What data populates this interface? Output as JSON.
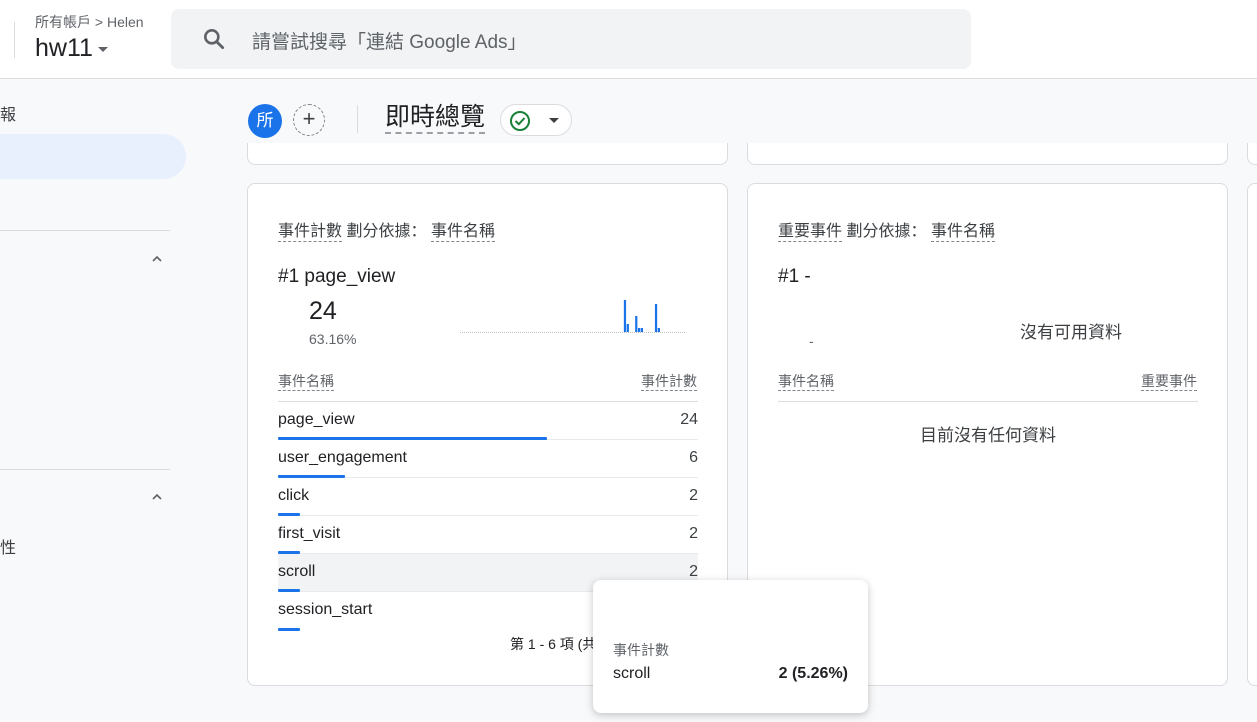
{
  "topbar": {
    "breadcrumb": "所有帳戶 > Helen",
    "account_name": "hw11",
    "search_placeholder": "請嘗試搜尋「連結 Google Ads」"
  },
  "sidebar": {
    "item_report_partial": "報",
    "item_attr_partial": "性"
  },
  "header": {
    "avatar_letter": "所",
    "add_label": "+",
    "page_title": "即時總覽"
  },
  "events_card": {
    "metric_label": "事件計數",
    "by_label": "劃分依據：",
    "dimension_label": "事件名稱",
    "top_rank": "#1",
    "top_name": "page_view",
    "top_value": "24",
    "top_percent": "63.16%",
    "col_name": "事件名稱",
    "col_value": "事件計數",
    "rows": [
      {
        "name": "page_view",
        "value": "24"
      },
      {
        "name": "user_engagement",
        "value": "6"
      },
      {
        "name": "click",
        "value": "2"
      },
      {
        "name": "first_visit",
        "value": "2"
      },
      {
        "name": "scroll",
        "value": "2"
      },
      {
        "name": "session_start",
        "value": ""
      }
    ],
    "pager": "第 1 - 6 項 (共"
  },
  "conversions_card": {
    "metric_label": "重要事件",
    "by_label": "劃分依據：",
    "dimension_label": "事件名稱",
    "top_rank": "#1",
    "top_name": "-",
    "top_value": "-",
    "no_data": "沒有可用資料",
    "col_name": "事件名稱",
    "col_value": "重要事件",
    "empty_table": "目前沒有任何資料"
  },
  "tooltip": {
    "metric": "事件計數",
    "name": "scroll",
    "value": "2 (5.26%)"
  },
  "chart_data": {
    "type": "bar",
    "title": "",
    "series": [
      {
        "values": [
          0,
          0,
          0,
          0,
          0,
          0,
          0,
          0,
          0,
          0,
          0,
          0,
          0,
          0,
          0,
          0,
          0,
          0,
          0,
          0,
          0,
          0,
          0,
          0,
          0,
          0,
          0,
          0,
          0,
          0,
          0,
          0,
          0,
          0,
          0,
          0,
          0,
          0,
          0,
          0,
          0,
          0,
          0,
          0,
          0,
          0,
          0,
          0,
          0,
          0,
          0,
          0,
          0,
          0,
          0,
          0,
          0,
          0,
          8,
          2,
          0,
          0,
          4,
          1,
          1,
          0,
          0,
          0,
          0,
          7,
          1,
          0,
          0,
          0,
          0,
          0,
          0,
          0,
          0,
          0
        ]
      }
    ],
    "row_share": [
      24,
      6,
      2,
      2,
      2,
      2
    ],
    "brand_color": "#1a73e8"
  }
}
